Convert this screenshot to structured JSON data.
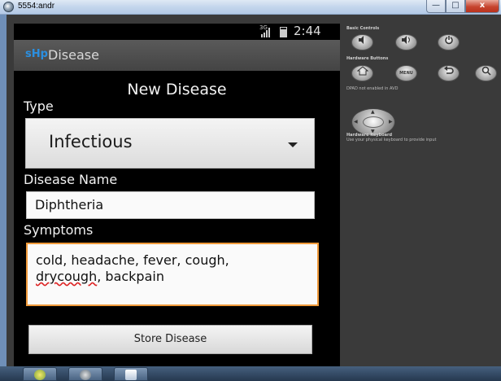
{
  "window": {
    "title": "5554:andr",
    "min_label": "—",
    "max_label": "□",
    "close_label": "x"
  },
  "status_bar": {
    "network": "3G",
    "time": "2:44"
  },
  "action_bar": {
    "logo_text": "sHp",
    "title": "Disease"
  },
  "form": {
    "heading": "New Disease",
    "type_label": "Type",
    "type_value": "Infectious",
    "name_label": "Disease Name",
    "name_value": "Diphtheria",
    "symptoms_label": "Symptoms",
    "symptoms_line1": "cold, headache, fever, cough,",
    "symptoms_misspelled": "drycough",
    "symptoms_rest": ", backpain",
    "store_button": "Store Disease"
  },
  "controls": {
    "basic_label": "Basic Controls",
    "hardware_label": "Hardware Buttons",
    "menu_label": "MENU",
    "dpad_label": "DPAD not enabled in AVD",
    "keyboard_label": "Hardware Keyboard",
    "keyboard_note": "Use your physical keyboard to provide input"
  },
  "colors": {
    "focus_border": "#f09a3a",
    "logo_blue": "#2b8fe0"
  }
}
